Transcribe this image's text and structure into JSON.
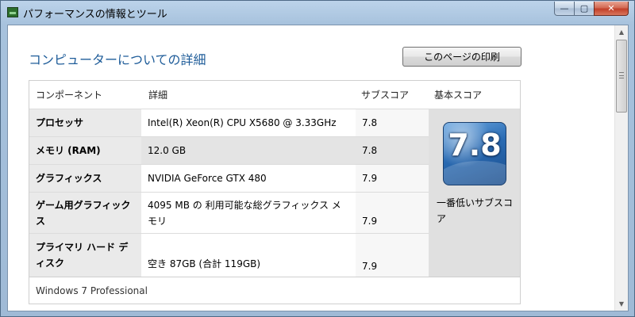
{
  "window": {
    "title": "パフォーマンスの情報とツール",
    "minimize_label": "—",
    "maximize_label": "▢",
    "close_label": "✕"
  },
  "page": {
    "title": "コンピューターについての詳細",
    "print_label": "このページの印刷"
  },
  "table": {
    "headers": {
      "component": "コンポーネント",
      "detail": "詳細",
      "subscore": "サブスコア",
      "basescore": "基本スコア"
    },
    "rows": [
      {
        "name": "プロセッサ",
        "detail": "Intel(R) Xeon(R) CPU X5680 @ 3.33GHz",
        "subscore": "7.8"
      },
      {
        "name": "メモリ (RAM)",
        "detail": "12.0 GB",
        "subscore": "7.8"
      },
      {
        "name": "グラフィックス",
        "detail": "NVIDIA GeForce GTX 480",
        "subscore": "7.9"
      },
      {
        "name": "ゲーム用グラフィックス",
        "detail": "4095 MB の 利用可能な総グラフィックス メモリ",
        "subscore": "7.9"
      },
      {
        "name": "プライマリ ハード ディスク",
        "detail": "空き 87GB (合計 119GB)",
        "subscore": "7.9"
      }
    ],
    "base_score": "7.8",
    "base_score_caption": "一番低いサブスコア",
    "os": "Windows 7 Professional"
  },
  "scrollbar": {
    "up_icon": "▲",
    "down_icon": "▼"
  }
}
